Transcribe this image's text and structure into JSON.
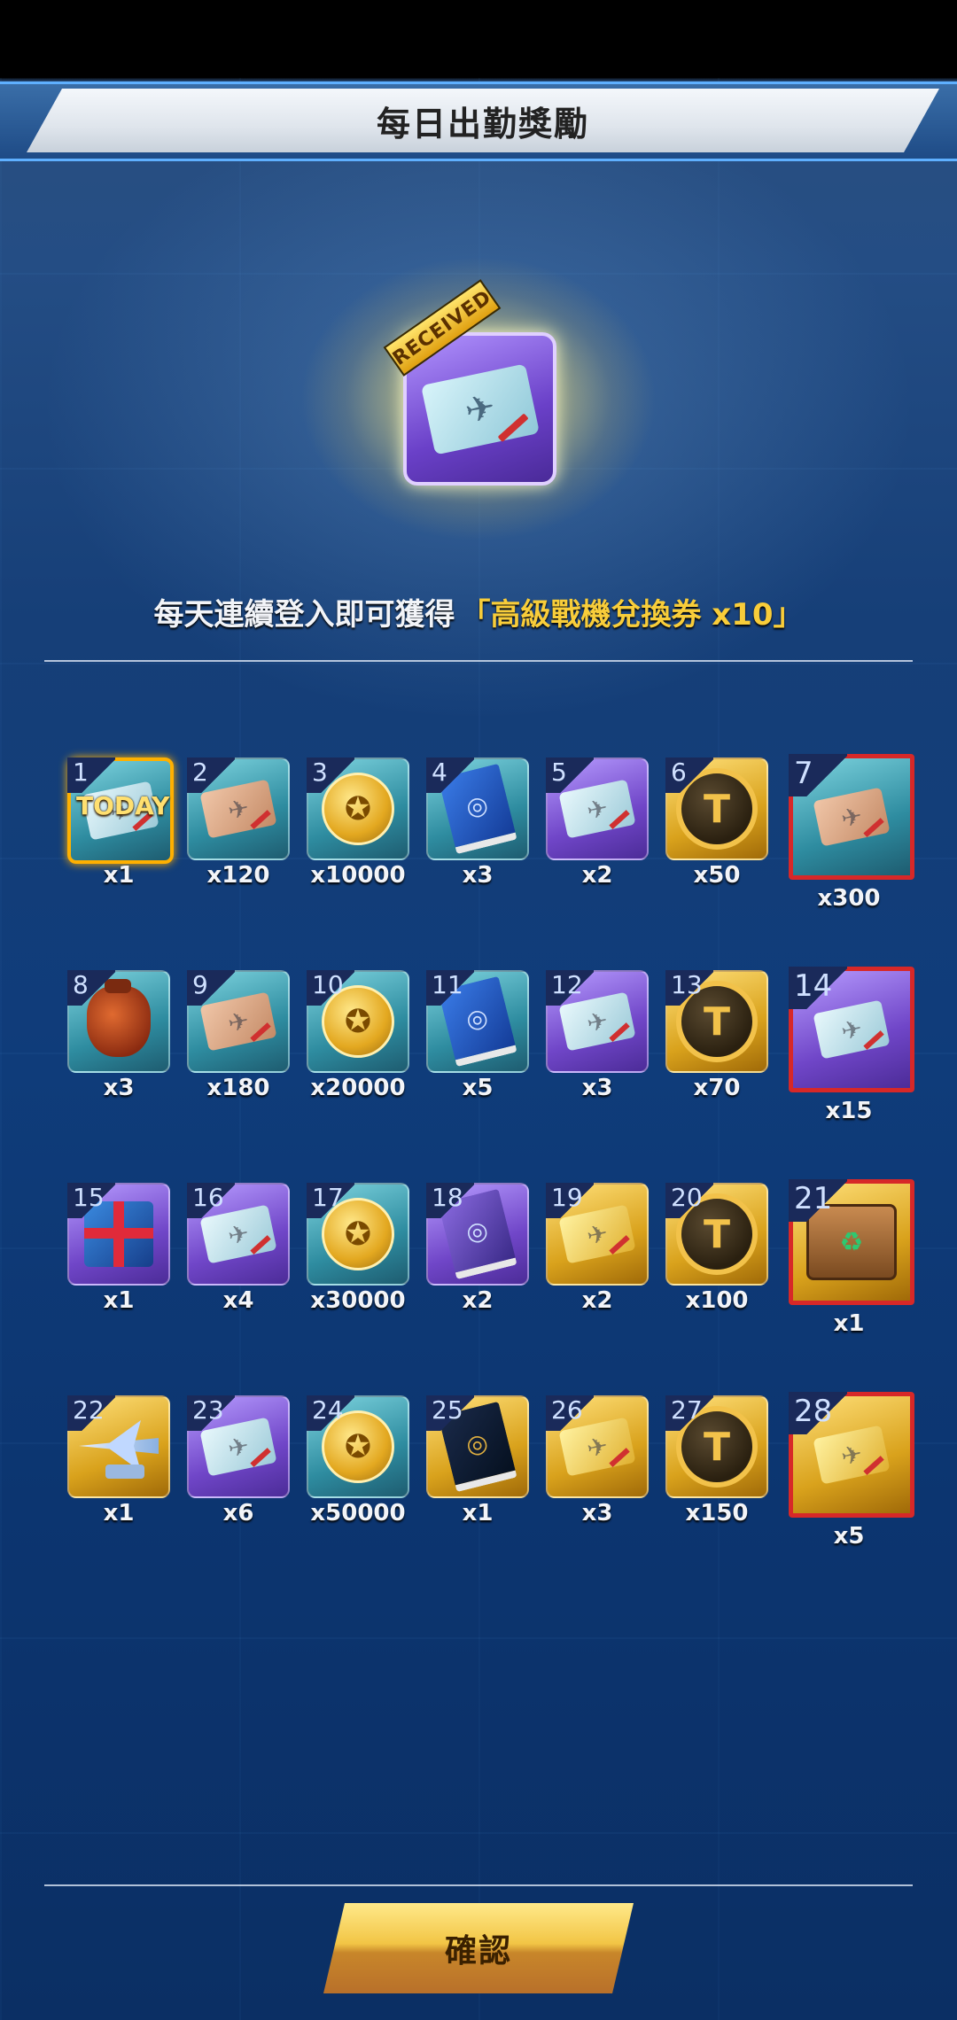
{
  "title": "每日出勤獎勵",
  "hero": {
    "received_label": "RECEIVED",
    "icon": "plane-ticket-icon"
  },
  "subtitle": {
    "text": "每天連續登入即可獲得",
    "highlight": "「高級戰機兌換券 x10」"
  },
  "today_label": "TODAY",
  "rewards": [
    {
      "day": "1",
      "qty": "x1",
      "bg": "teal",
      "icon": "silver-ticket"
    },
    {
      "day": "2",
      "qty": "x120",
      "bg": "teal",
      "icon": "bronze-ticket"
    },
    {
      "day": "3",
      "qty": "x10000",
      "bg": "teal",
      "icon": "gold-coin"
    },
    {
      "day": "4",
      "qty": "x3",
      "bg": "teal",
      "icon": "blue-book"
    },
    {
      "day": "5",
      "qty": "x2",
      "bg": "purple",
      "icon": "silver-ticket"
    },
    {
      "day": "6",
      "qty": "x50",
      "bg": "gold",
      "icon": "t-coin"
    },
    {
      "day": "7",
      "qty": "x300",
      "bg": "teal",
      "icon": "bronze-ticket"
    },
    {
      "day": "8",
      "qty": "x3",
      "bg": "teal",
      "icon": "money-bag"
    },
    {
      "day": "9",
      "qty": "x180",
      "bg": "teal",
      "icon": "bronze-ticket"
    },
    {
      "day": "10",
      "qty": "x20000",
      "bg": "teal",
      "icon": "gold-coin"
    },
    {
      "day": "11",
      "qty": "x5",
      "bg": "teal",
      "icon": "blue-book"
    },
    {
      "day": "12",
      "qty": "x3",
      "bg": "purple",
      "icon": "silver-ticket"
    },
    {
      "day": "13",
      "qty": "x70",
      "bg": "gold",
      "icon": "t-coin"
    },
    {
      "day": "14",
      "qty": "x15",
      "bg": "purple",
      "icon": "silver-ticket"
    },
    {
      "day": "15",
      "qty": "x1",
      "bg": "purple",
      "icon": "gift-box"
    },
    {
      "day": "16",
      "qty": "x4",
      "bg": "purple",
      "icon": "silver-ticket"
    },
    {
      "day": "17",
      "qty": "x30000",
      "bg": "teal",
      "icon": "gold-coin"
    },
    {
      "day": "18",
      "qty": "x2",
      "bg": "purple",
      "icon": "purple-book"
    },
    {
      "day": "19",
      "qty": "x2",
      "bg": "gold",
      "icon": "gold-ticket"
    },
    {
      "day": "20",
      "qty": "x100",
      "bg": "gold",
      "icon": "t-coin"
    },
    {
      "day": "21",
      "qty": "x1",
      "bg": "gold",
      "icon": "supply-crate"
    },
    {
      "day": "22",
      "qty": "x1",
      "bg": "gold",
      "icon": "jet-model"
    },
    {
      "day": "23",
      "qty": "x6",
      "bg": "purple",
      "icon": "silver-ticket"
    },
    {
      "day": "24",
      "qty": "x50000",
      "bg": "teal",
      "icon": "gold-coin"
    },
    {
      "day": "25",
      "qty": "x1",
      "bg": "gold",
      "icon": "navy-book"
    },
    {
      "day": "26",
      "qty": "x3",
      "bg": "gold",
      "icon": "gold-ticket"
    },
    {
      "day": "27",
      "qty": "x150",
      "bg": "gold",
      "icon": "t-coin"
    },
    {
      "day": "28",
      "qty": "x5",
      "bg": "gold",
      "icon": "gold-ticket"
    }
  ],
  "confirm_label": "確認",
  "colors": {
    "highlight": "#f8cd3a",
    "big_border": "#d72828",
    "today_border": "#ffb000"
  }
}
